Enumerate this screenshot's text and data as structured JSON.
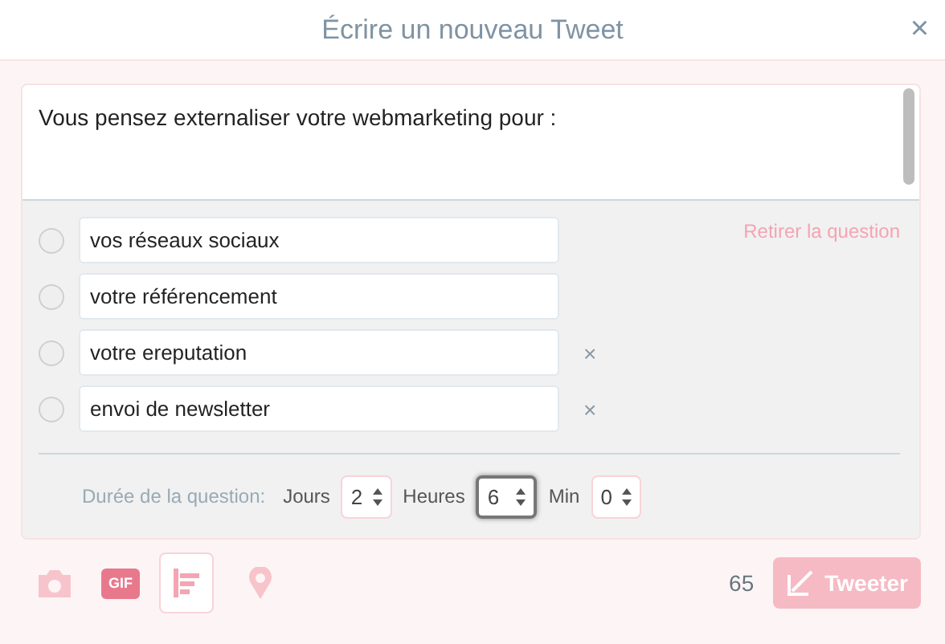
{
  "dialog": {
    "title": "Écrire un nouveau Tweet",
    "close": "×"
  },
  "tweet_text": "Vous pensez externaliser votre webmarketing pour :",
  "poll": {
    "remove_label": "Retirer la question",
    "options": [
      {
        "value": "vos réseaux sociaux",
        "selected": false
      },
      {
        "value": "votre référencement",
        "selected": false
      },
      {
        "value": "votre ereputation",
        "selected": false,
        "remove": "×"
      },
      {
        "value": "envoi de newsletter",
        "selected": false,
        "remove": "×"
      }
    ],
    "duration_label": "Durée de la question:",
    "fields": [
      {
        "label": "Jours",
        "value": "2",
        "focused": false
      },
      {
        "label": "Heures",
        "value": "6",
        "focused": true
      },
      {
        "label": "Min",
        "value": "0",
        "focused": false
      }
    ]
  },
  "toolbar": {
    "gif_label": "GIF",
    "poll_active": true
  },
  "char_count": "65",
  "tweet_button": "Tweeter"
}
